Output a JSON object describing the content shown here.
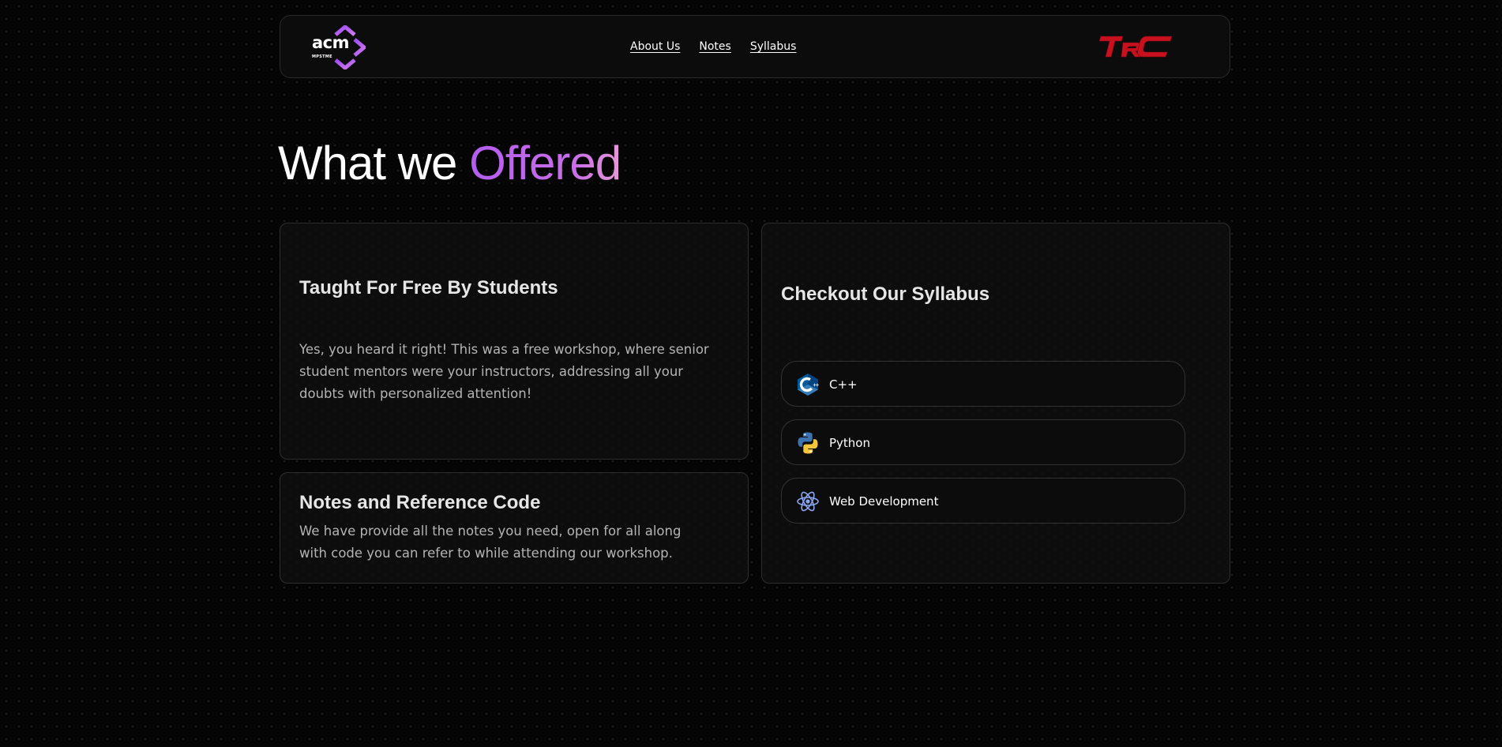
{
  "navbar": {
    "acm_logo_text": "acm",
    "acm_logo_sub": "MPSTME",
    "links": [
      {
        "label": "About Us"
      },
      {
        "label": "Notes"
      },
      {
        "label": "Syllabus"
      }
    ],
    "trc_logo_text": "TRC"
  },
  "heading": {
    "prefix": "What we ",
    "accent": "Offered"
  },
  "cards": {
    "free": {
      "title": "Taught For Free By Students",
      "text": "Yes, you heard it right! This was a free workshop, where senior student mentors were your instructors, addressing all your doubts with personalized attention!"
    },
    "notes": {
      "title": "Notes and Reference Code",
      "text": "We have provide all the notes you need, open for all along with code you can refer to while attending our workshop."
    },
    "syllabus": {
      "title": "Checkout Our Syllabus",
      "items": [
        {
          "label": "C++",
          "icon": "cpp-icon"
        },
        {
          "label": "Python",
          "icon": "python-icon"
        },
        {
          "label": "Web Development",
          "icon": "react-icon"
        }
      ]
    }
  },
  "colors": {
    "background": "#050505",
    "accent_purple": "#b35df0",
    "trc_red": "#c8101e",
    "acm_purple": "#b45ef0"
  }
}
